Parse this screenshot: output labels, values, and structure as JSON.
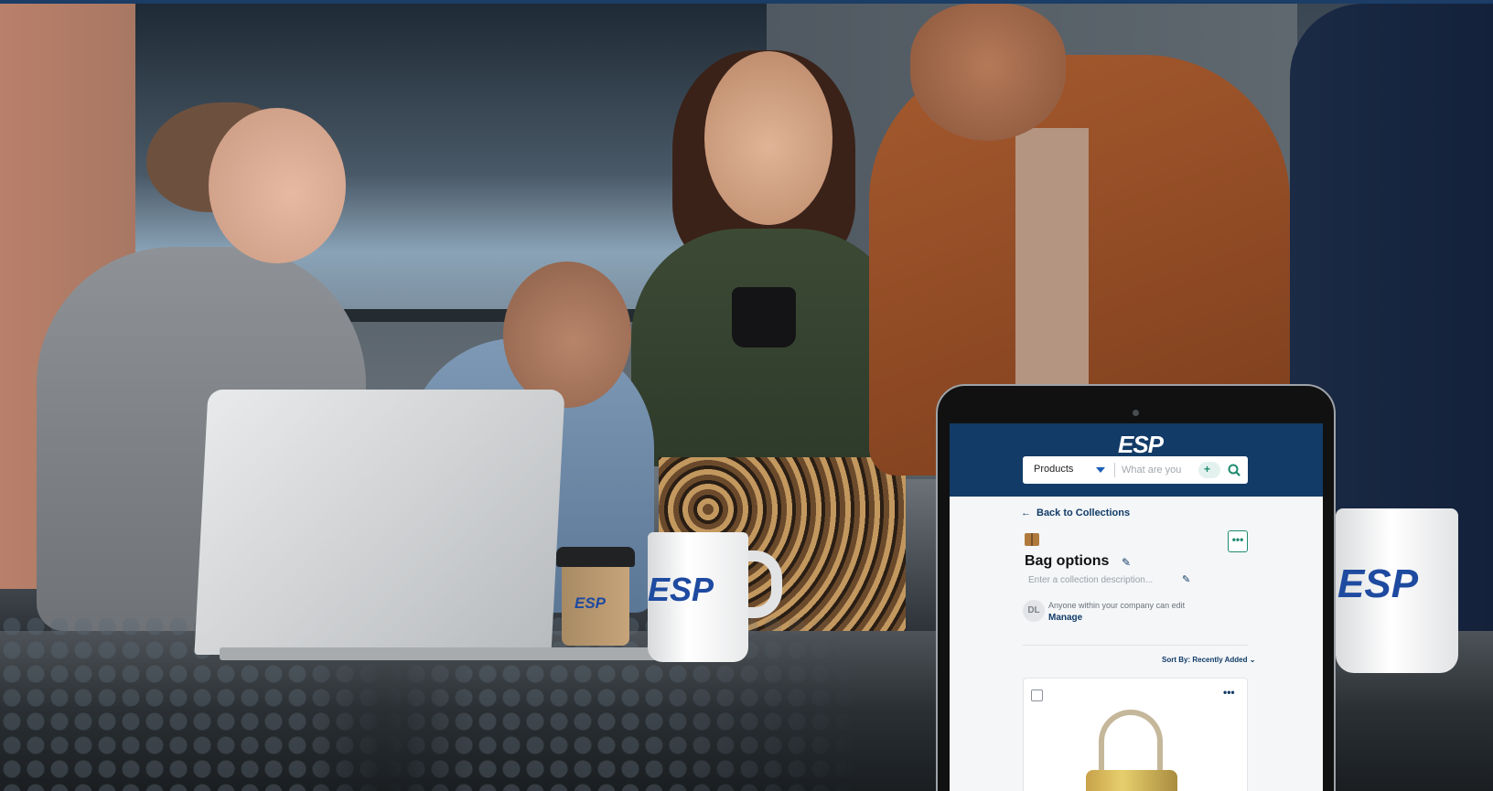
{
  "branding": {
    "mug_logo": "ESP",
    "mug_right_logo": "ESP",
    "cup_logo": "ESP",
    "colors": {
      "brand_navy": "#123b67",
      "brand_blue": "#1e4aa0",
      "accent_green": "#1f8a70"
    }
  },
  "app": {
    "logo": "ESP",
    "search": {
      "category": "Products",
      "placeholder": "What are you",
      "icons": [
        "chevron-down-icon",
        "ai-sparkle-icon",
        "search-icon"
      ]
    },
    "back_link": "Back to Collections",
    "collection": {
      "title": "Bag options",
      "description_placeholder": "Enter a collection description...",
      "more_label": "•••"
    },
    "permissions": {
      "avatar_initials": "DL",
      "text": "Anyone within your company can edit",
      "manage_label": "Manage"
    },
    "sort_label": "Sort By: Recently Added",
    "card": {
      "more_label": "•••"
    }
  }
}
